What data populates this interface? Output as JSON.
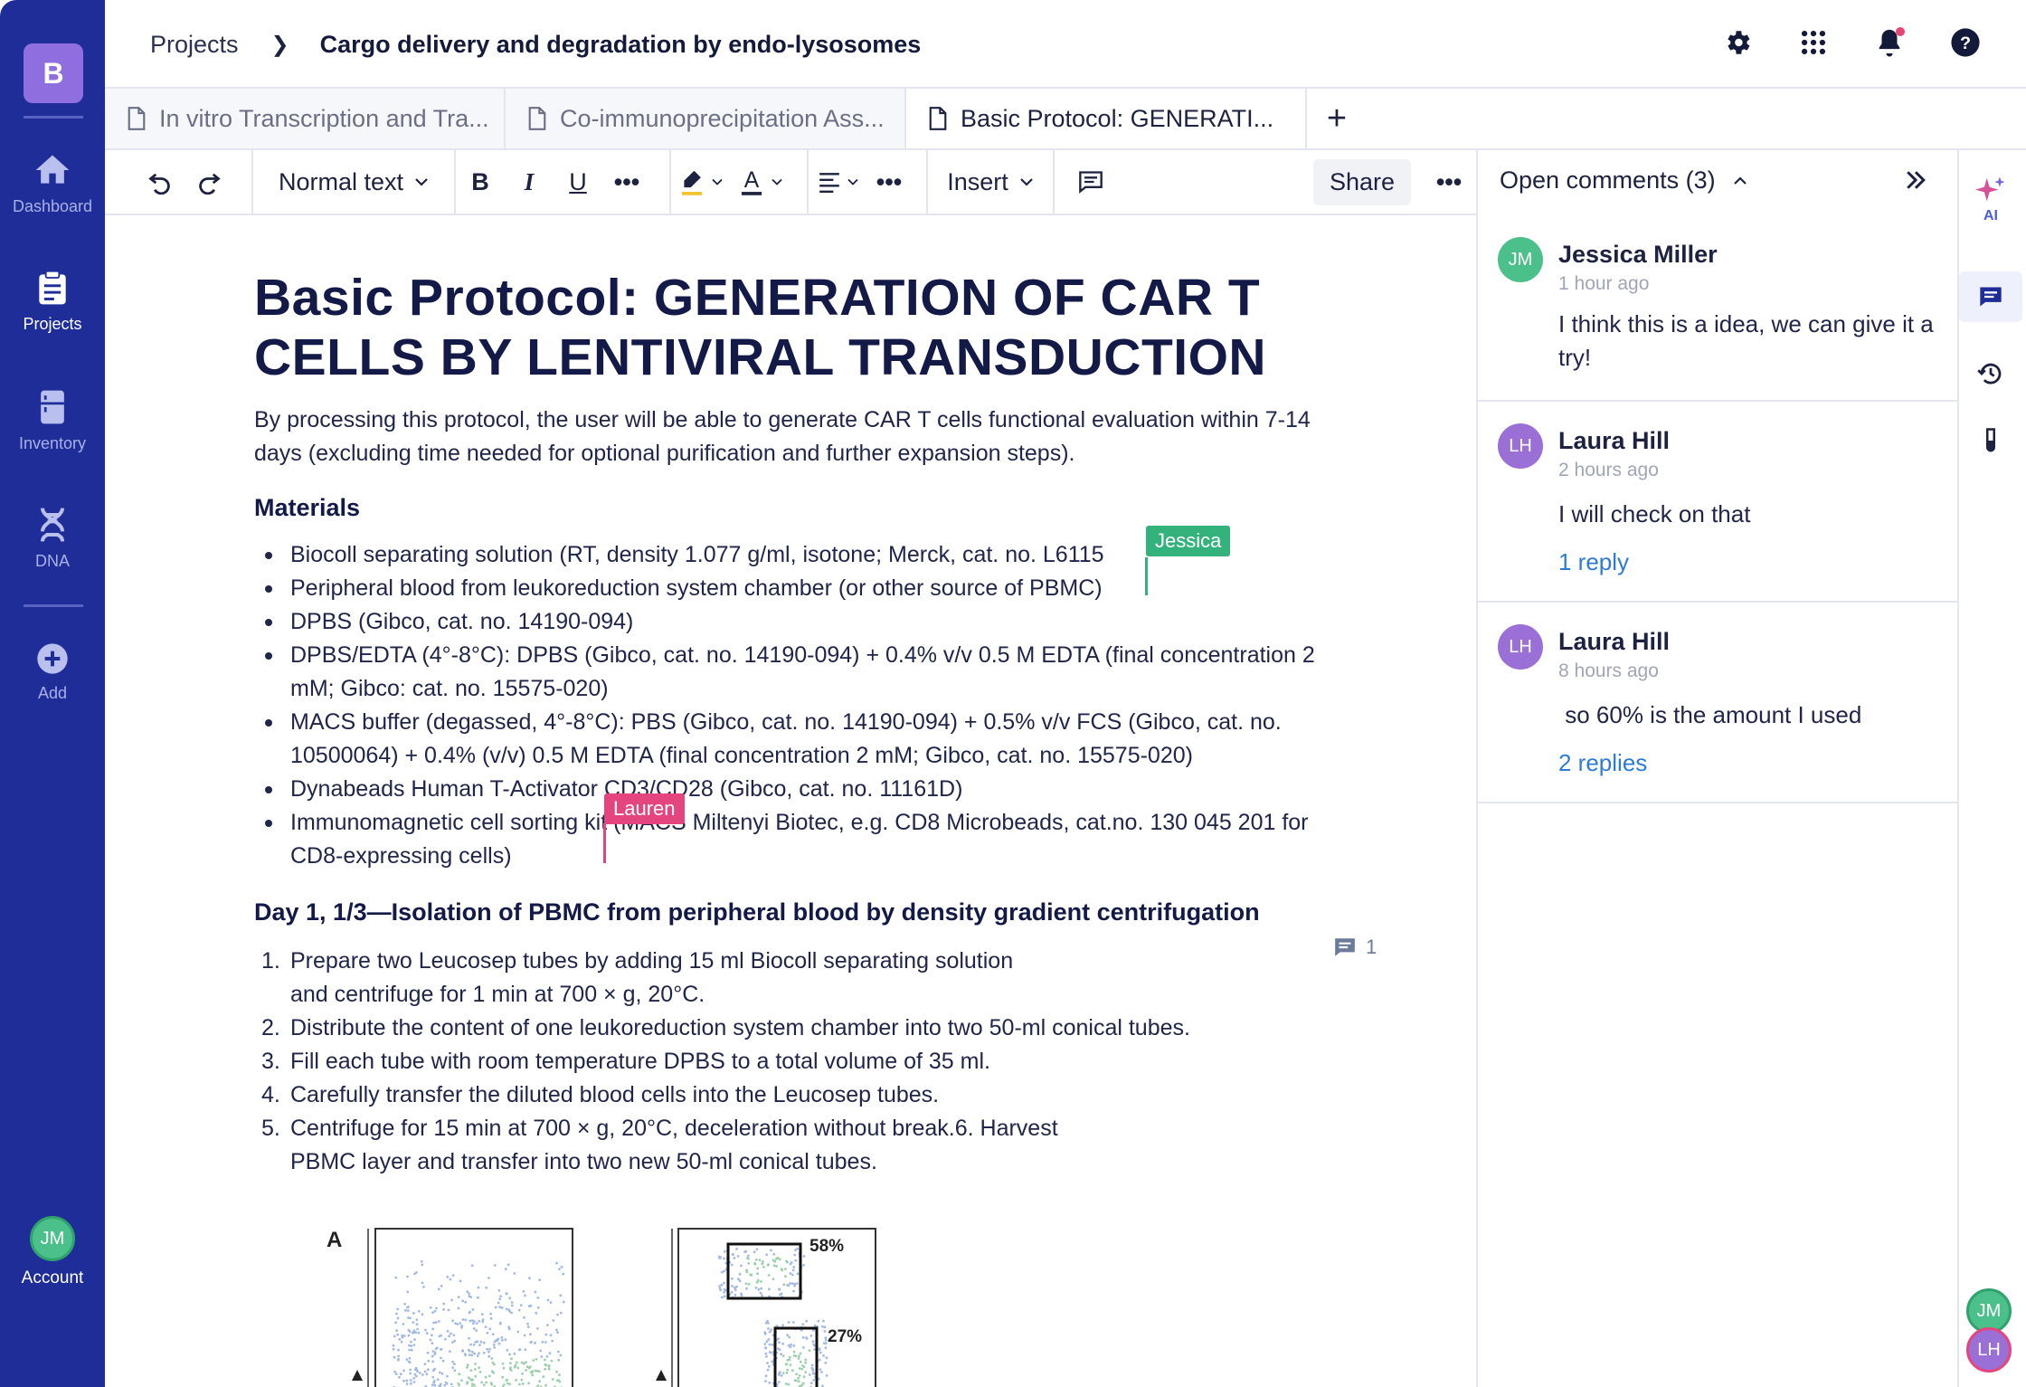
{
  "nav": {
    "brand": "B",
    "items": [
      {
        "label": "Dashboard",
        "icon": "home-icon"
      },
      {
        "label": "Projects",
        "icon": "clipboard-icon"
      },
      {
        "label": "Inventory",
        "icon": "fridge-icon"
      },
      {
        "label": "DNA",
        "icon": "dna-icon"
      },
      {
        "label": "Add",
        "icon": "plus-circle-icon"
      }
    ],
    "account": {
      "initials": "JM",
      "label": "Account"
    }
  },
  "header": {
    "breadcrumb": [
      "Projects",
      "Cargo delivery and degradation by endo-lysosomes"
    ],
    "icons": [
      "gear-icon",
      "apps-grid-icon",
      "bell-icon",
      "help-icon"
    ]
  },
  "tabs": [
    {
      "label": "In vitro Transcription and Tra..."
    },
    {
      "label": "Co-immunoprecipitation Ass..."
    },
    {
      "label": "Basic Protocol: GENERATI...",
      "active": true
    }
  ],
  "tab_add": "+",
  "toolbar": {
    "text_style": "Normal text",
    "insert": "Insert",
    "share": "Share"
  },
  "doc": {
    "title": "Basic Protocol: GENERATION OF CAR T CELLS BY LENTIVIRAL TRANSDUCTION",
    "intro": "By processing this protocol, the user will be able to generate CAR T cells functional evaluation within 7-14 days (excluding time needed for optional purification and further expansion steps).",
    "materials_heading": "Materials",
    "materials": [
      "Biocoll separating solution (RT, density 1.077 g/ml, isotone; Merck, cat. no. L6115",
      "Peripheral blood from leukoreduction system chamber (or other source of PBMC)",
      "DPBS (Gibco, cat. no. 14190-094)",
      "DPBS/EDTA (4°-8°C): DPBS (Gibco, cat. no. 14190-094) + 0.4% v/v 0.5 M EDTA (final concentration 2 mM; Gibco: cat. no. 15575-020)",
      "MACS buffer (degassed, 4°-8°C): PBS (Gibco, cat. no. 14190-094) + 0.5% v/v FCS (Gibco, cat. no. 10500064) + 0.4% (v/v) 0.5 M EDTA (final concentration 2 mM; Gibco, cat. no. 15575-020)",
      "Dynabeads Human T-Activator CD3/CD28 (Gibco, cat. no. 11161D)",
      "Immunomagnetic cell sorting kit (MACS Miltenyi Biotec, e.g. CD8 Microbeads, cat.no. 130 045 201 for CD8-expressing cells)"
    ],
    "day_heading": "Day 1, 1/3—Isolation of PBMC from peripheral blood by density gradient centrifugation",
    "steps": [
      "Prepare two Leucosep tubes by adding 15 ml Biocoll separating solution and centrifuge for 1 min at 700 × g, 20°C.",
      "Distribute the content of one leukoreduction system chamber into two 50-ml conical tubes.",
      "Fill each tube with room temperature DPBS to a total volume of 35 ml.",
      "Carefully transfer the diluted blood cells into the Leucosep tubes.",
      "Centrifuge for 15 min at 700 × g, 20°C, deceleration without break.6. Harvest PBMC layer and transfer into two new 50-ml conical tubes."
    ],
    "step_comment_count": "1",
    "cursors": [
      {
        "name": "Jessica",
        "color": "#34b27b"
      },
      {
        "name": "Lauren",
        "color": "#e4457f"
      }
    ],
    "figure": {
      "panel_label": "A",
      "gate_labels": [
        "58%",
        "27%"
      ]
    }
  },
  "comments_panel": {
    "title": "Open comments (3)",
    "comments": [
      {
        "initials": "JM",
        "name": "Jessica Miller",
        "time": "1 hour ago",
        "text": "I think this is a idea, we can give it a try!",
        "color": "#4cc08a"
      },
      {
        "initials": "LH",
        "name": "Laura Hill",
        "time": "2 hours ago",
        "text": "I will check on that",
        "replies": "1 reply",
        "color": "#9a6fd6"
      },
      {
        "initials": "LH",
        "name": "Laura Hill",
        "time": "8 hours ago",
        "text": " so 60% is the amount I used",
        "replies": "2 replies",
        "color": "#9a6fd6"
      }
    ]
  },
  "rail": {
    "ai_label": "AI",
    "icons": [
      "sparkle-icon",
      "comment-icon",
      "history-icon",
      "test-tube-icon"
    ],
    "presence": [
      "JM",
      "LH"
    ]
  }
}
